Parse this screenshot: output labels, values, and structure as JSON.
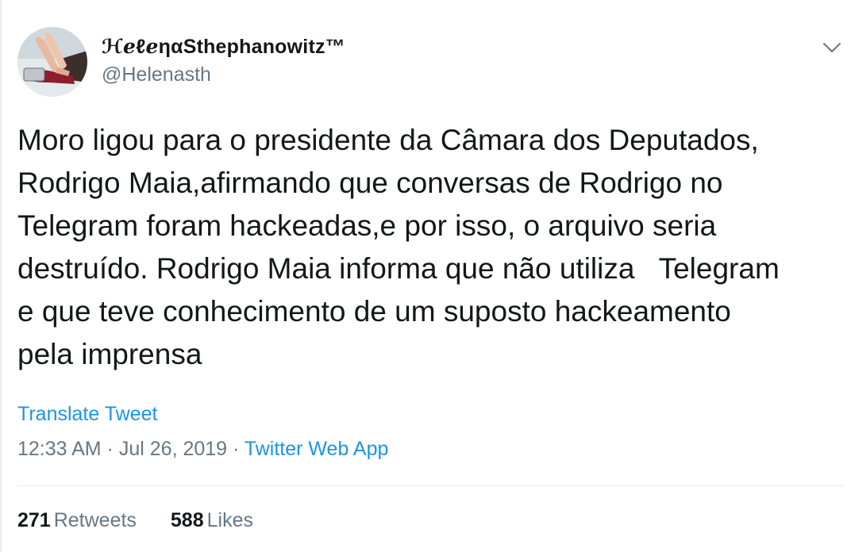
{
  "tweet": {
    "author": {
      "display_name": "ℋℯℓℯηαSthephanowitz™",
      "handle": "@Helenasth"
    },
    "text": "Moro ligou para o presidente da Câmara dos Deputados,\nRodrigo Maia,afirmando que conversas de Rodrigo no\nTelegram foram hackeadas,e por isso, o arquivo seria\ndestruído. Rodrigo Maia informa que não utiliza   Telegram\ne que teve conhecimento de um suposto hackeamento\npela imprensa",
    "translate_label": "Translate Tweet",
    "time": "12:33 AM",
    "separator": " · ",
    "date": "Jul 26, 2019",
    "source": "Twitter Web App",
    "stats": {
      "retweets_count": "271",
      "retweets_label": "Retweets",
      "likes_count": "588",
      "likes_label": "Likes"
    },
    "icons": {
      "caret": "chevron-down-icon"
    },
    "colors": {
      "link": "#1b95e0",
      "secondary_text": "#657786",
      "primary_text": "#14171a",
      "divider": "#e6ecf0"
    }
  }
}
